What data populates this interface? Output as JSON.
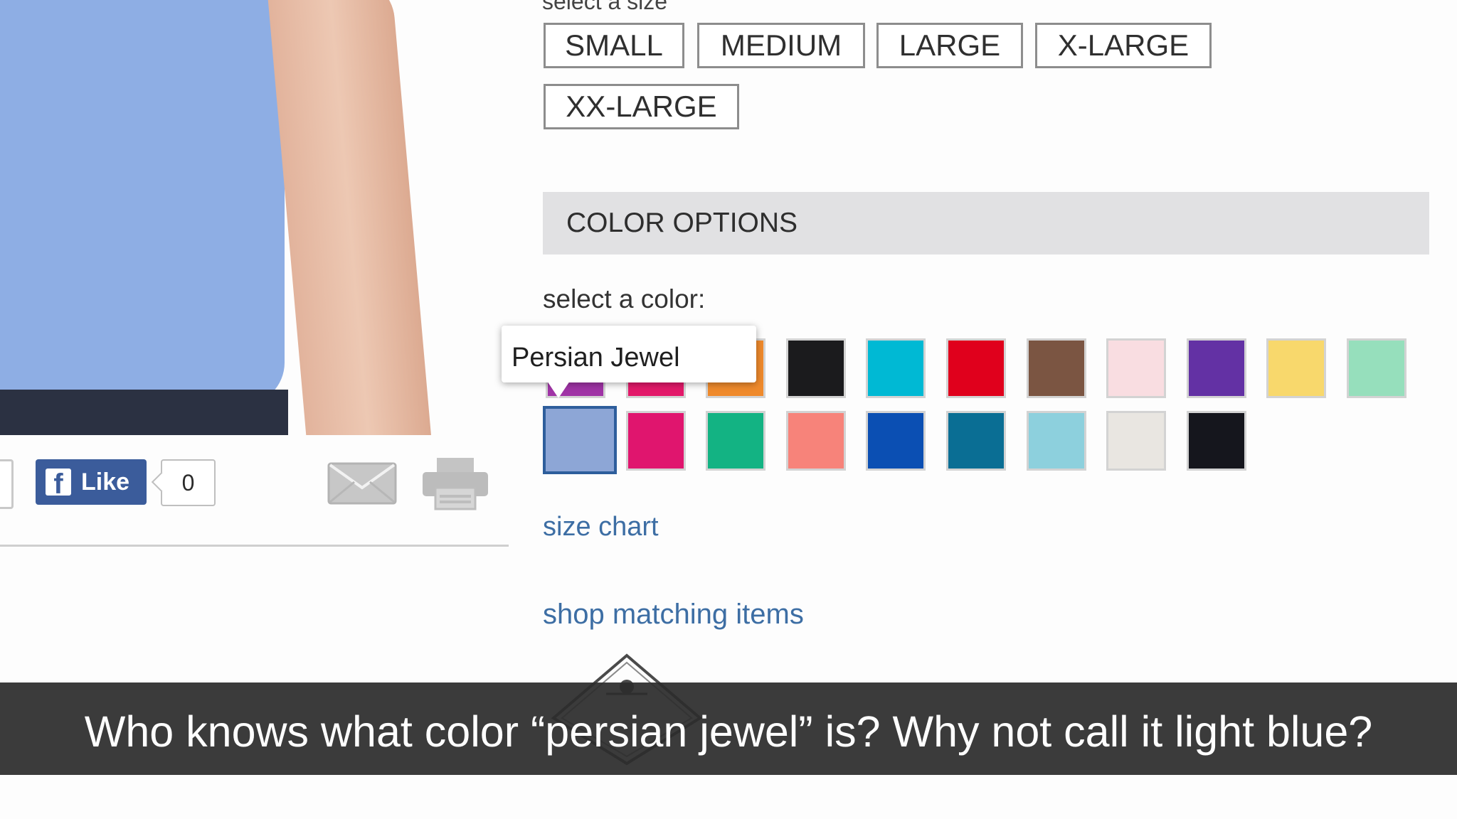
{
  "size_section": {
    "heading": "select a size",
    "sizes": [
      "SMALL",
      "MEDIUM",
      "LARGE",
      "X-LARGE",
      "XX-LARGE"
    ]
  },
  "color_section": {
    "header": "COLOR OPTIONS",
    "prompt": "select a color:",
    "tooltip": "Persian Jewel",
    "selected_color": "Persian Jewel",
    "swatches_row1": [
      "#a034a6",
      "#e3196a",
      "#ef8a2c",
      "#1b1b1d",
      "#00b9d4",
      "#e0001c",
      "#7b5542",
      "#f9dde1",
      "#6331a4",
      "#f8d86c",
      "#96dfbc"
    ],
    "swatches_row2": [
      "#8da6d6",
      "#e0156e",
      "#13b383",
      "#f7837a",
      "#0b4fb3",
      "#0a6e94",
      "#8dd0dd",
      "#e9e6e1",
      "#15161d"
    ]
  },
  "links": {
    "size_chart": "size chart",
    "shop_matching": "shop matching items"
  },
  "social": {
    "like_label": "Like",
    "like_count": "0"
  },
  "caption": "Who knows what color “persian jewel” is? Why not call it light blue?",
  "colors": {
    "link": "#3d6ea4",
    "facebook": "#3b5c9b",
    "header_bg": "#e1e1e3",
    "selected_border": "#2e5e9c"
  }
}
